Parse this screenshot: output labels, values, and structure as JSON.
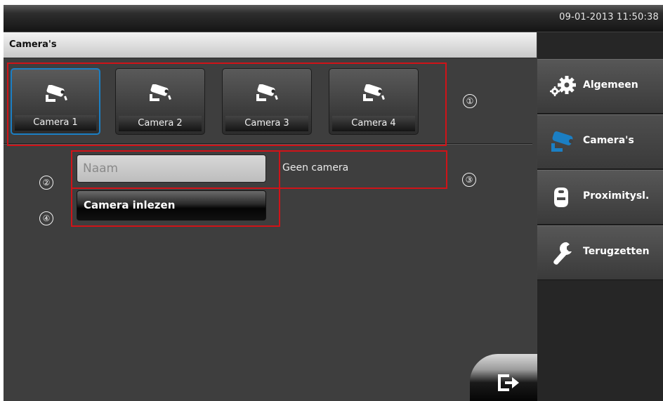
{
  "status_bar": {
    "datetime": "09-01-2013 11:50:38"
  },
  "title_bar": {
    "title": "Camera's"
  },
  "cameras": [
    {
      "label": "Camera 1",
      "selected": true
    },
    {
      "label": "Camera 2",
      "selected": false
    },
    {
      "label": "Camera 3",
      "selected": false
    },
    {
      "label": "Camera 4",
      "selected": false
    }
  ],
  "annotations": [
    "①",
    "②",
    "③",
    "④"
  ],
  "form": {
    "name_placeholder": "Naam",
    "name_value": "",
    "status_text": "Geen camera",
    "read_button_label": "Camera inlezen"
  },
  "sidebar": {
    "items": [
      {
        "label": "Algemeen",
        "icon": "gear-icon",
        "active": false
      },
      {
        "label": "Camera's",
        "icon": "camera-icon",
        "active": true
      },
      {
        "label": "Proximitysl.",
        "icon": "proximity-tag-icon",
        "active": false
      },
      {
        "label": "Terugzetten",
        "icon": "wrench-icon",
        "active": false
      }
    ]
  },
  "colors": {
    "accent_blue": "#1b7fc4",
    "annotation_red": "#d01318",
    "panel_bg": "#3e3e3e"
  }
}
